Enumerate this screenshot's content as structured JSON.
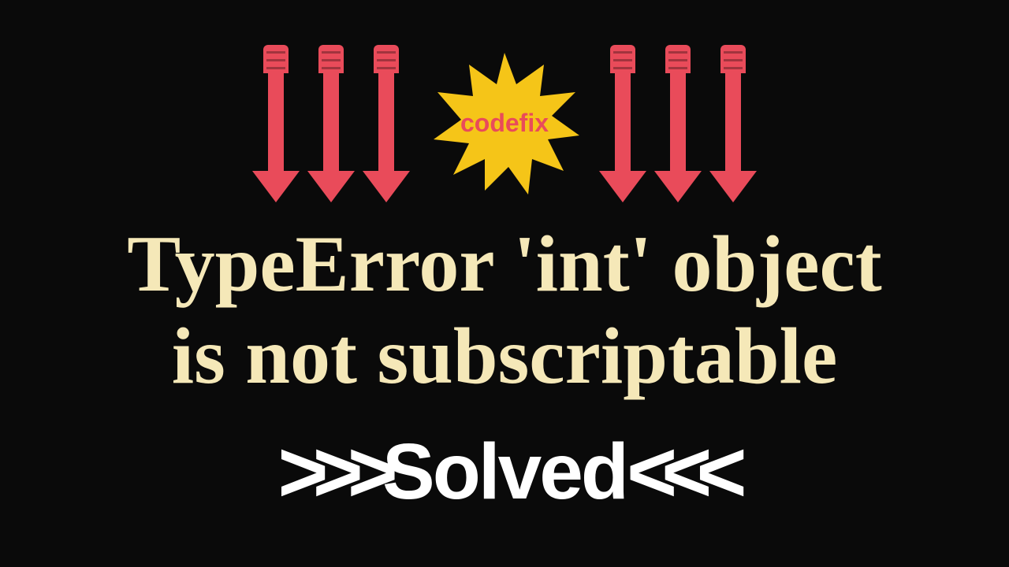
{
  "burst": {
    "label": "codefix",
    "bg_color": "#f5c518",
    "text_color": "#e94b5a"
  },
  "arrows": {
    "color": "#e94b5a",
    "count_left": 3,
    "count_right": 3
  },
  "title": {
    "line1": "TypeError 'int' object",
    "line2": "is not subscriptable",
    "color": "#f5e8b8"
  },
  "solved": {
    "left_chevrons": ">>>",
    "text": "Solved",
    "right_chevrons": "<<<",
    "color": "#ffffff"
  }
}
